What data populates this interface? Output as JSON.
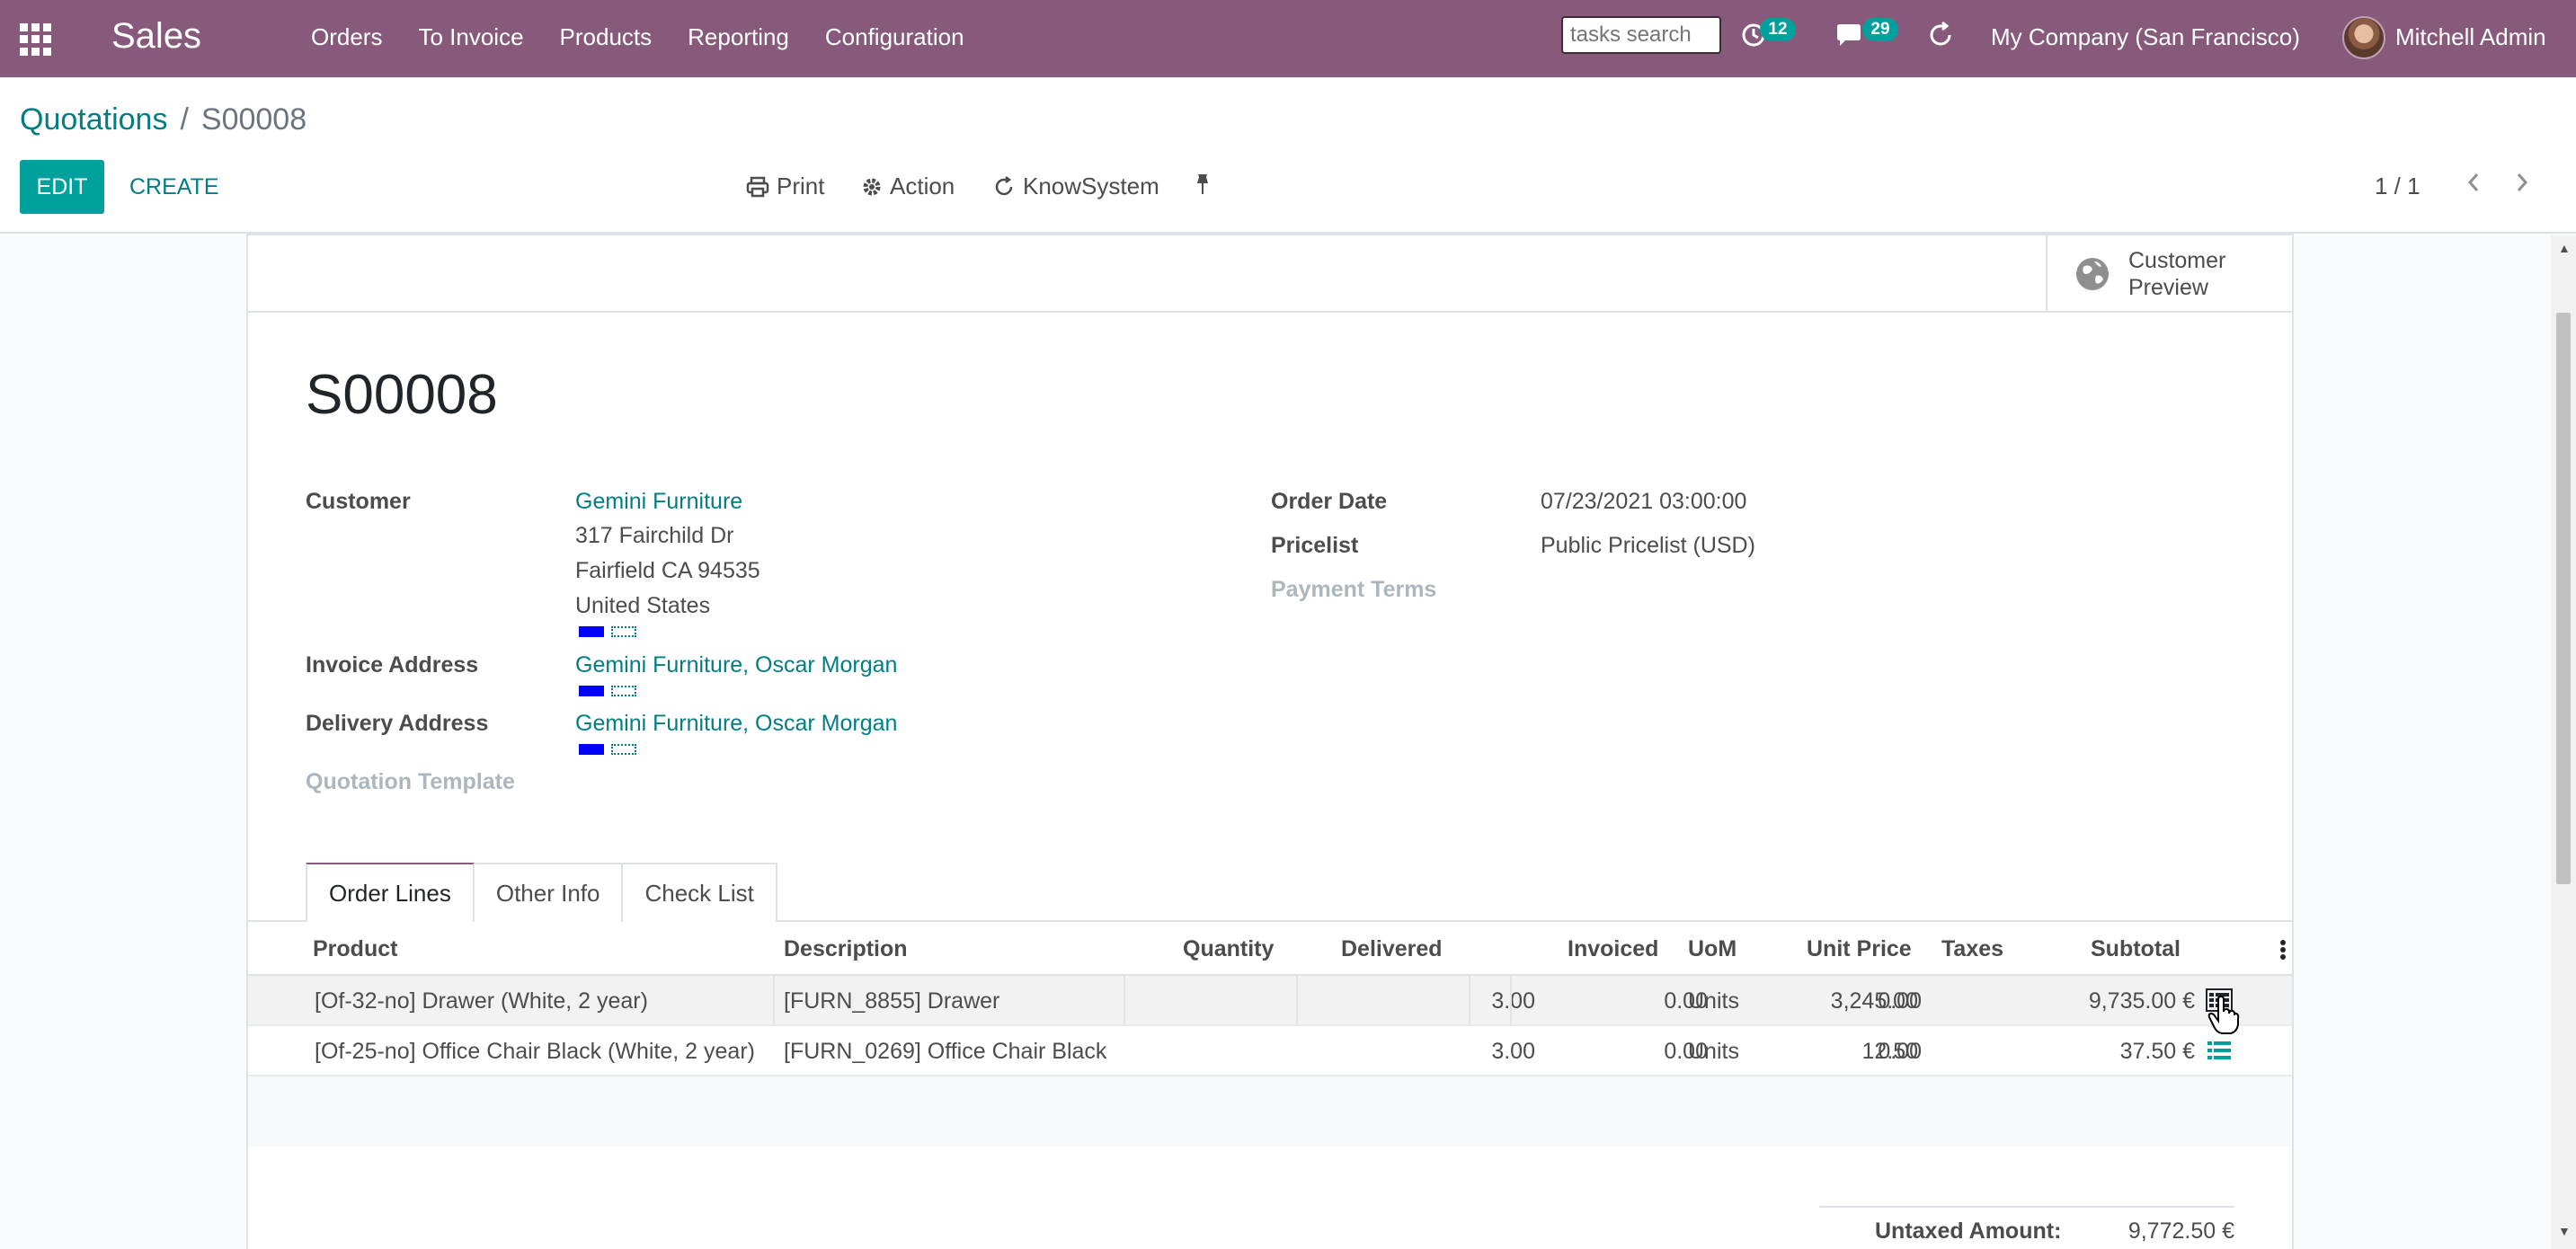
{
  "app": {
    "title": "Sales",
    "menu": [
      "Orders",
      "To Invoice",
      "Products",
      "Reporting",
      "Configuration"
    ],
    "search_placeholder": "tasks search",
    "activities_count": "12",
    "messages_count": "29",
    "company": "My Company (San Francisco)",
    "user": "Mitchell Admin",
    "brand_color": "#875a7b",
    "accent_color": "#00a09d"
  },
  "breadcrumb": {
    "parent": "Quotations",
    "separator": "/",
    "current": "S00008"
  },
  "toolbar": {
    "edit_label": "EDIT",
    "create_label": "CREATE",
    "print_label": "Print",
    "action_label": "Action",
    "knowsystem_label": "KnowSystem",
    "pager": "1 / 1"
  },
  "form": {
    "preview_line1": "Customer",
    "preview_line2": "Preview",
    "name": "S00008",
    "customer_label": "Customer",
    "customer_name": "Gemini Furniture",
    "customer_street": "317 Fairchild Dr",
    "customer_city": "Fairfield CA 94535",
    "customer_country": "United States",
    "invoice_address_label": "Invoice Address",
    "invoice_address": "Gemini Furniture, Oscar Morgan",
    "delivery_address_label": "Delivery Address",
    "delivery_address": "Gemini Furniture, Oscar Morgan",
    "quotation_template_label": "Quotation Template",
    "order_date_label": "Order Date",
    "order_date": "07/23/2021 03:00:00",
    "pricelist_label": "Pricelist",
    "pricelist": "Public Pricelist (USD)",
    "payment_terms_label": "Payment Terms"
  },
  "tabs": [
    "Order Lines",
    "Other Info",
    "Check List"
  ],
  "order_lines": {
    "headers": [
      "Product",
      "Description",
      "Quantity",
      "Delivered",
      "Invoiced",
      "UoM",
      "Unit Price",
      "Taxes",
      "Subtotal"
    ],
    "rows": [
      {
        "product": "[Of-32-no] Drawer (White, 2 year)",
        "description": "[FURN_8855] Drawer",
        "quantity": "3.00",
        "delivered": "0.00",
        "invoiced": "0.00",
        "uom": "Units",
        "unit_price": "3,245.00",
        "taxes": "",
        "subtotal": "9,735.00 €"
      },
      {
        "product": "[Of-25-no] Office Chair Black (White, 2 year)",
        "description": "[FURN_0269] Office Chair Black",
        "quantity": "3.00",
        "delivered": "0.00",
        "invoiced": "0.00",
        "uom": "Units",
        "unit_price": "12.50",
        "taxes": "",
        "subtotal": "37.50 €"
      }
    ]
  },
  "totals": {
    "untaxed_label": "Untaxed Amount:",
    "untaxed_value": "9,772.50 €"
  }
}
